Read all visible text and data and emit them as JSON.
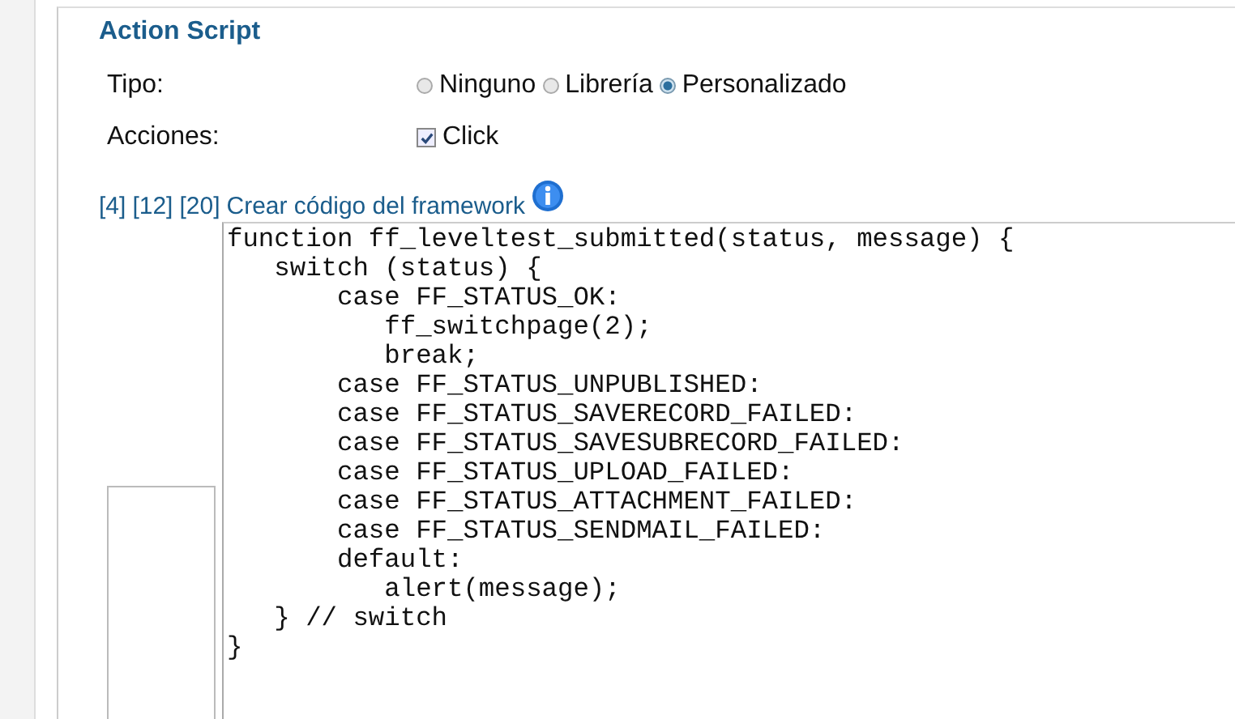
{
  "section": {
    "title": "Action Script"
  },
  "tipo": {
    "label": "Tipo:",
    "options": [
      {
        "label": "Ninguno",
        "selected": false
      },
      {
        "label": "Librería",
        "selected": false
      },
      {
        "label": "Personalizado",
        "selected": true
      }
    ]
  },
  "acciones": {
    "label": "Acciones:",
    "options": [
      {
        "label": "Click",
        "checked": true
      }
    ]
  },
  "links": [
    "[4]",
    "[12]",
    "[20]",
    "Crear código del framework"
  ],
  "code": [
    "function ff_leveltest_submitted(status, message) {",
    "   switch (status) {",
    "       case FF_STATUS_OK:",
    "          ff_switchpage(2);",
    "          break;",
    "       case FF_STATUS_UNPUBLISHED:",
    "       case FF_STATUS_SAVERECORD_FAILED:",
    "       case FF_STATUS_SAVESUBRECORD_FAILED:",
    "       case FF_STATUS_UPLOAD_FAILED:",
    "       case FF_STATUS_ATTACHMENT_FAILED:",
    "       case FF_STATUS_SENDMAIL_FAILED:",
    "       default:",
    "          alert(message);",
    "   } // switch",
    "}"
  ]
}
